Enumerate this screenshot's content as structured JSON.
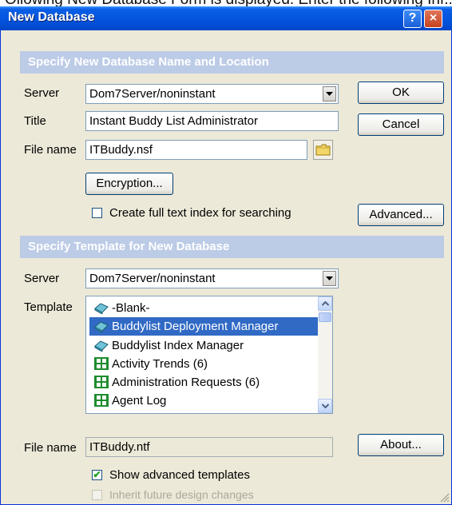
{
  "top_cut_text": "Ollowing New Database Form is displayed. Enter the following Inf...",
  "window": {
    "title": "New Database",
    "help_glyph": "?",
    "close_glyph": "×"
  },
  "section1": {
    "header": "Specify New Database Name and Location",
    "server_label": "Server",
    "server_value": "Dom7Server/noninstant",
    "title_label": "Title",
    "title_value": "Instant Buddy List Administrator",
    "filename_label": "File name",
    "filename_value": "ITBuddy.nsf",
    "encryption_button": "Encryption...",
    "fulltext_label": "Create full text index for searching",
    "fulltext_checked": false
  },
  "buttons": {
    "ok": "OK",
    "cancel": "Cancel",
    "advanced": "Advanced...",
    "about": "About..."
  },
  "section2": {
    "header": "Specify Template for New Database",
    "server_label": "Server",
    "server_value": "Dom7Server/noninstant",
    "template_label": "Template",
    "templates": [
      {
        "label": "-Blank-",
        "icon": "book-icon",
        "selected": false
      },
      {
        "label": "Buddylist Deployment Manager",
        "icon": "book-icon",
        "selected": true
      },
      {
        "label": "Buddylist Index Manager",
        "icon": "book-icon",
        "selected": false
      },
      {
        "label": "Activity Trends (6)",
        "icon": "domino-db-icon",
        "selected": false
      },
      {
        "label": "Administration Requests (6)",
        "icon": "domino-db-icon",
        "selected": false
      },
      {
        "label": "Agent Log",
        "icon": "domino-db-icon",
        "selected": false
      }
    ],
    "filename_label": "File name",
    "filename_value": "ITBuddy.ntf",
    "show_advanced_label": "Show advanced templates",
    "show_advanced_checked": true,
    "inherit_label": "Inherit future design changes",
    "inherit_checked": false,
    "inherit_disabled": true
  },
  "colors": {
    "titlebar": "#0453DC",
    "dialog_bg": "#ECE9D8",
    "section_header": "#BCCBE6",
    "selection": "#316AC5"
  }
}
